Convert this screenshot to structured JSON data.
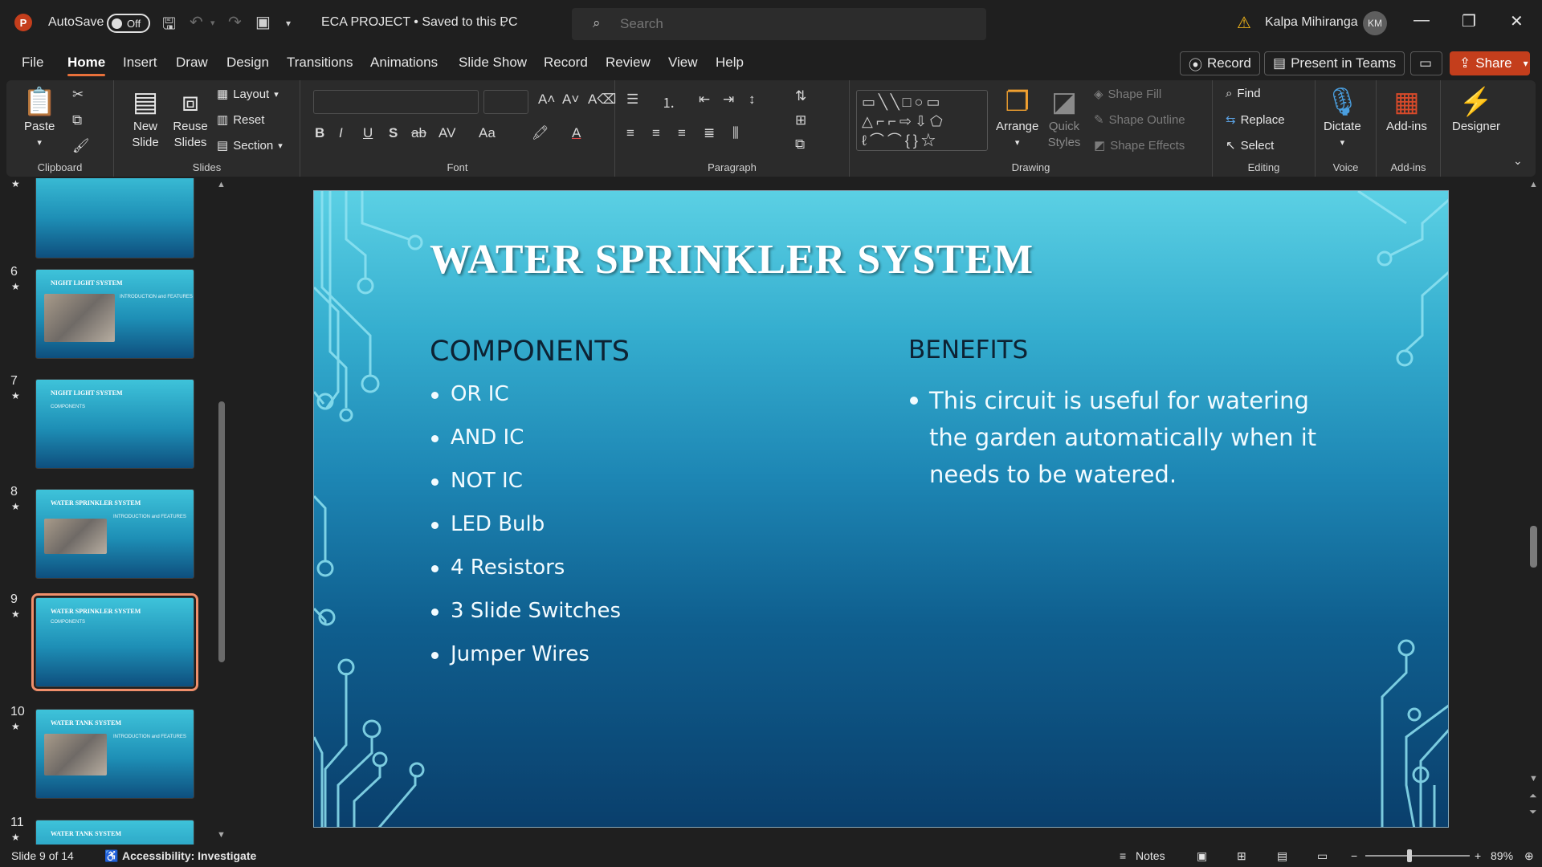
{
  "titlebar": {
    "app_icon": "P",
    "autosave_label": "AutoSave",
    "autosave_state": "Off",
    "doc_title": "ECA PROJECT • Saved to this PC",
    "search_placeholder": "Search",
    "user_name": "Kalpa Mihiranga",
    "user_initials": "KM",
    "icons": [
      "save-icon",
      "undo-icon",
      "redo-icon",
      "present-icon",
      "customize-icon",
      "warning-icon",
      "minimize-icon",
      "restore-icon",
      "close-icon"
    ]
  },
  "menu": {
    "tabs": [
      "File",
      "Home",
      "Insert",
      "Draw",
      "Design",
      "Transitions",
      "Animations",
      "Slide Show",
      "Record",
      "Review",
      "View",
      "Help"
    ],
    "active": "Home",
    "record_btn": "Record",
    "teams_btn": "Present in Teams",
    "share_btn": "Share"
  },
  "ribbon": {
    "clipboard": {
      "label": "Clipboard",
      "paste": "Paste"
    },
    "slides": {
      "label": "Slides",
      "new_slide": "New Slide",
      "reuse_slides": "Reuse Slides",
      "layout": "Layout",
      "reset": "Reset",
      "section": "Section"
    },
    "font": {
      "label": "Font",
      "bold": "B",
      "italic": "I",
      "underline": "U",
      "shadow": "S",
      "strike": "ab",
      "spacing": "AV",
      "case": "Aa"
    },
    "paragraph": {
      "label": "Paragraph"
    },
    "drawing": {
      "label": "Drawing",
      "arrange": "Arrange",
      "quick_styles": "Quick Styles",
      "shape_fill": "Shape Fill",
      "shape_outline": "Shape Outline",
      "shape_effects": "Shape Effects"
    },
    "editing": {
      "label": "Editing",
      "find": "Find",
      "replace": "Replace",
      "select": "Select"
    },
    "voice": {
      "label": "Voice",
      "dictate": "Dictate"
    },
    "addins": {
      "label": "Add-ins",
      "addins": "Add-ins"
    },
    "designer": {
      "label": "Designer"
    }
  },
  "thumbnails": [
    {
      "num": "6",
      "title": "NIGHT LIGHT SYSTEM",
      "subtitle": "INTRODUCTION and FEATURES"
    },
    {
      "num": "7",
      "title": "NIGHT LIGHT SYSTEM",
      "subtitle": "COMPONENTS"
    },
    {
      "num": "8",
      "title": "WATER SPRINKLER SYSTEM",
      "subtitle": "INTRODUCTION and FEATURES"
    },
    {
      "num": "9",
      "title": "WATER SPRINKLER SYSTEM",
      "subtitle": "COMPONENTS",
      "selected": true
    },
    {
      "num": "10",
      "title": "WATER TANK SYSTEM",
      "subtitle": "INTRODUCTION and FEATURES"
    },
    {
      "num": "11",
      "title": "WATER TANK SYSTEM",
      "subtitle": ""
    }
  ],
  "slide": {
    "title": "WATER SPRINKLER SYSTEM",
    "components_heading": "COMPONENTS",
    "components": [
      "OR IC",
      "AND IC",
      "NOT IC",
      "LED Bulb",
      "4 Resistors",
      "3 Slide Switches",
      "Jumper Wires"
    ],
    "benefits_heading": "BENEFITS",
    "benefits_text": "This circuit is useful for watering the garden automatically when it needs to be watered."
  },
  "status": {
    "slide_info": "Slide 9 of 14",
    "accessibility": "Accessibility: Investigate",
    "notes": "Notes",
    "zoom": "89%"
  },
  "colors": {
    "accent": "#c43e1c",
    "tab_underline": "#e8703a",
    "selected_thumb": "#f08f6b"
  }
}
